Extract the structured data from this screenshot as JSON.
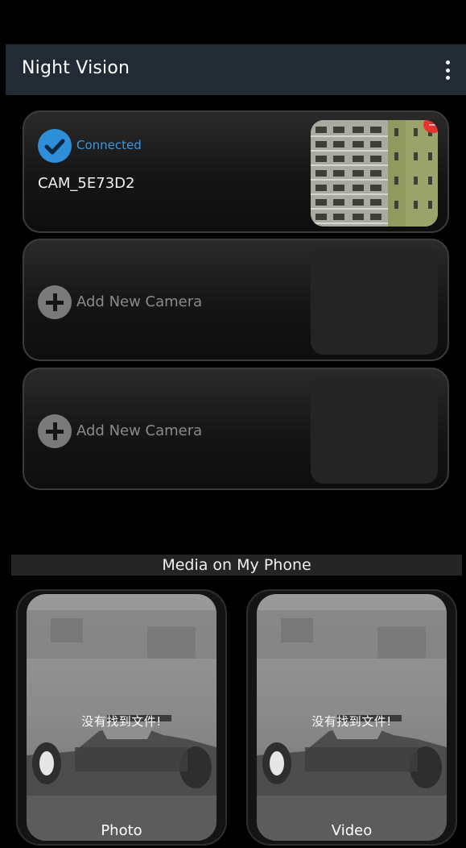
{
  "app": {
    "title": "Night Vision"
  },
  "cameras": [
    {
      "status": "Connected",
      "name": "CAM_5E73D2"
    },
    {
      "add_label": "Add New Camera"
    },
    {
      "add_label": "Add New Camera"
    }
  ],
  "media": {
    "header": "Media on My Phone",
    "tiles": [
      {
        "empty_message": "没有找到文件!",
        "label": "Photo"
      },
      {
        "empty_message": "没有找到文件!",
        "label": "Video"
      }
    ]
  },
  "colors": {
    "app_bar": "#222a34",
    "accent": "#2f8ed8",
    "status_text": "#3d97de",
    "badge": "#e8322e"
  },
  "icons": [
    "overflow-menu-icon",
    "check-circle-icon",
    "add-circle-icon",
    "notification-badge-icon"
  ]
}
